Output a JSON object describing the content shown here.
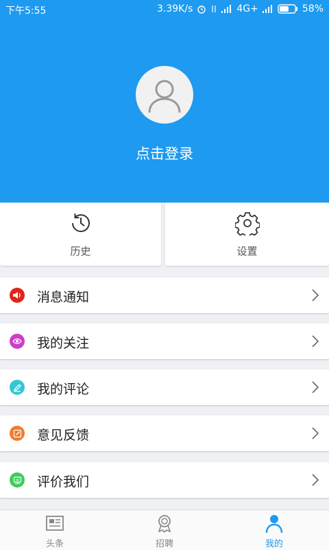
{
  "status": {
    "time": "下午5:55",
    "speed": "3.39K/s",
    "network": "4G+",
    "battery": "58%"
  },
  "profile": {
    "login_text": "点击登录"
  },
  "quick": [
    {
      "label": "历史",
      "icon": "history-icon"
    },
    {
      "label": "设置",
      "icon": "gear-icon"
    }
  ],
  "menu": [
    {
      "label": "消息通知",
      "icon": "speaker-icon",
      "color": "#e0251b"
    },
    {
      "label": "我的关注",
      "icon": "eye-icon",
      "color": "#cc3fc8"
    },
    {
      "label": "我的评论",
      "icon": "pencil-icon",
      "color": "#35c6d4"
    },
    {
      "label": "意见反馈",
      "icon": "edit-icon",
      "color": "#f07c2e"
    },
    {
      "label": "评价我们",
      "icon": "rate-icon",
      "color": "#3fcb5c"
    }
  ],
  "tabs": [
    {
      "label": "头条",
      "icon": "news-icon",
      "active": false
    },
    {
      "label": "招聘",
      "icon": "badge-icon",
      "active": false
    },
    {
      "label": "我的",
      "icon": "person-icon",
      "active": true
    }
  ],
  "colors": {
    "primary": "#1e9af0"
  }
}
